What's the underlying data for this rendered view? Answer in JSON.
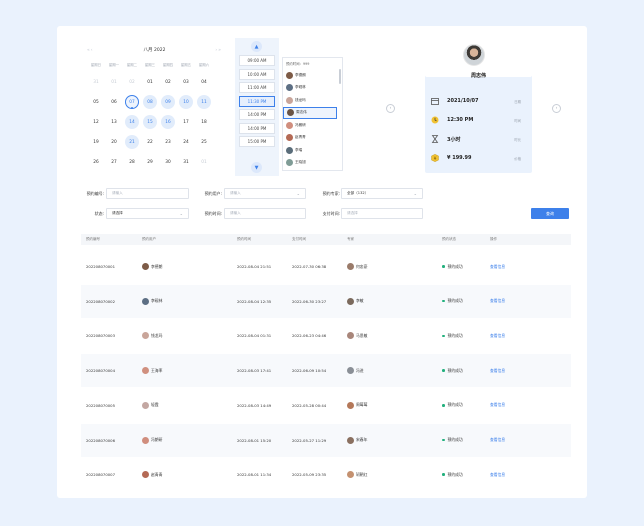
{
  "calendar": {
    "month_label": "八月 2022",
    "weekdays": [
      "星期日",
      "星期一",
      "星期二",
      "星期三",
      "星期四",
      "星期五",
      "星期六"
    ],
    "days": [
      {
        "d": "31",
        "s": "muted"
      },
      {
        "d": "01",
        "s": "muted"
      },
      {
        "d": "02",
        "s": "muted"
      },
      {
        "d": "01",
        "s": ""
      },
      {
        "d": "02",
        "s": ""
      },
      {
        "d": "03",
        "s": ""
      },
      {
        "d": "04",
        "s": ""
      },
      {
        "d": "05",
        "s": ""
      },
      {
        "d": "06",
        "s": ""
      },
      {
        "d": "07",
        "s": "sel"
      },
      {
        "d": "08",
        "s": "avail"
      },
      {
        "d": "09",
        "s": "avail"
      },
      {
        "d": "10",
        "s": "avail"
      },
      {
        "d": "11",
        "s": "avail"
      },
      {
        "d": "12",
        "s": ""
      },
      {
        "d": "13",
        "s": ""
      },
      {
        "d": "14",
        "s": "avail"
      },
      {
        "d": "15",
        "s": "avail"
      },
      {
        "d": "16",
        "s": "avail"
      },
      {
        "d": "17",
        "s": ""
      },
      {
        "d": "18",
        "s": ""
      },
      {
        "d": "19",
        "s": ""
      },
      {
        "d": "20",
        "s": ""
      },
      {
        "d": "21",
        "s": "avail"
      },
      {
        "d": "22",
        "s": ""
      },
      {
        "d": "23",
        "s": ""
      },
      {
        "d": "24",
        "s": ""
      },
      {
        "d": "25",
        "s": ""
      },
      {
        "d": "26",
        "s": ""
      },
      {
        "d": "27",
        "s": ""
      },
      {
        "d": "28",
        "s": ""
      },
      {
        "d": "29",
        "s": ""
      },
      {
        "d": "30",
        "s": ""
      },
      {
        "d": "31",
        "s": ""
      },
      {
        "d": "01",
        "s": "muted"
      }
    ]
  },
  "times": {
    "up_arrow": "^",
    "down_arrow": "v",
    "slots": [
      "09:00 AM",
      "10:00 AM",
      "11:00 AM",
      "11:30 PM",
      "14:00 PM",
      "14:00 PM",
      "15:00 PM"
    ],
    "selected_index": 3
  },
  "people": {
    "header": "预约时间：999",
    "list": [
      {
        "name": "李德朗",
        "color": "#7d5b47"
      },
      {
        "name": "李砚林",
        "color": "#5d6f84"
      },
      {
        "name": "钱龙玛",
        "color": "#c9a59a"
      },
      {
        "name": "周志伟",
        "color": "#6a5446"
      },
      {
        "name": "冯朗研",
        "color": "#d08e7e"
      },
      {
        "name": "赵青青",
        "color": "#b46a55"
      },
      {
        "name": "李瑞",
        "color": "#5a6d7a"
      },
      {
        "name": "王晓旭",
        "color": "#7f9c96"
      }
    ],
    "selected_index": 3
  },
  "detail": {
    "name": "周志伟",
    "date": "2021/10/07",
    "date_label": "日期",
    "time": "12:30 PM",
    "time_label": "时间",
    "duration": "3小时",
    "duration_label": "时长",
    "price": "¥ 199.99",
    "price_label": "价格"
  },
  "filters": {
    "r1": [
      {
        "label": "预约编号:",
        "placeholder": "请输入"
      },
      {
        "label": "预约用户:",
        "placeholder": "请输入"
      },
      {
        "label": "预约专家:",
        "value": "全部（132）"
      }
    ],
    "r2": [
      {
        "label": "状态:",
        "value": "请选择"
      },
      {
        "label": "预约时间:",
        "placeholder": "请输入"
      },
      {
        "label": "支付时间:",
        "placeholder": "请选择"
      }
    ],
    "query_label": "查询"
  },
  "table": {
    "headers": [
      "预约编号",
      "预约用户",
      "预约时间",
      "支付时间",
      "专家",
      "预约状态",
      "操作"
    ],
    "rows": [
      {
        "id": "202208070001",
        "user": "李德朗",
        "ucolor": "#7d5b47",
        "t1": "2022-08-04 21:51",
        "t2": "2022-07-30 06:38",
        "expert": "何忠豪",
        "ecolor": "#9a7b6a",
        "status": "预约成功",
        "op": "查看信息"
      },
      {
        "id": "202208070002",
        "user": "李砚林",
        "ucolor": "#5d6f84",
        "t1": "2022-08-04 12:35",
        "t2": "2022-06-30 23:27",
        "expert": "李敏",
        "ecolor": "#7b6a5d",
        "status": "预约成功",
        "op": "查看信息"
      },
      {
        "id": "202208070003",
        "user": "钱龙玛",
        "ucolor": "#c9a59a",
        "t1": "2022-08-04 01:31",
        "t2": "2022-06-23 04:46",
        "expert": "马思敏",
        "ecolor": "#a8867a",
        "status": "预约成功",
        "op": "查看信息"
      },
      {
        "id": "202208070004",
        "user": "王海率",
        "ucolor": "#d0907f",
        "t1": "2022-08-03 17:41",
        "t2": "2022-06-09 10:54",
        "expert": "冯进",
        "ecolor": "#8a8f96",
        "status": "预约成功",
        "op": "查看信息"
      },
      {
        "id": "202208070005",
        "user": "轻霞",
        "ucolor": "#c3a7a2",
        "t1": "2022-08-03 14:49",
        "t2": "2022-05-28 00:44",
        "expert": "周莓莓",
        "ecolor": "#b47859",
        "status": "预约成功",
        "op": "查看信息"
      },
      {
        "id": "202208070006",
        "user": "冯朗研",
        "ucolor": "#d08e7e",
        "t1": "2022-08-01 15:20",
        "t2": "2022-05-27 11:29",
        "expert": "宋春年",
        "ecolor": "#8a7060",
        "status": "预约成功",
        "op": "查看信息"
      },
      {
        "id": "202208070007",
        "user": "赵青青",
        "ucolor": "#b46a55",
        "t1": "2022-08-01 11:34",
        "t2": "2022-05-09 23:35",
        "expert": "轲朝红",
        "ecolor": "#c49170",
        "status": "预约成功",
        "op": "查看信息"
      }
    ]
  }
}
